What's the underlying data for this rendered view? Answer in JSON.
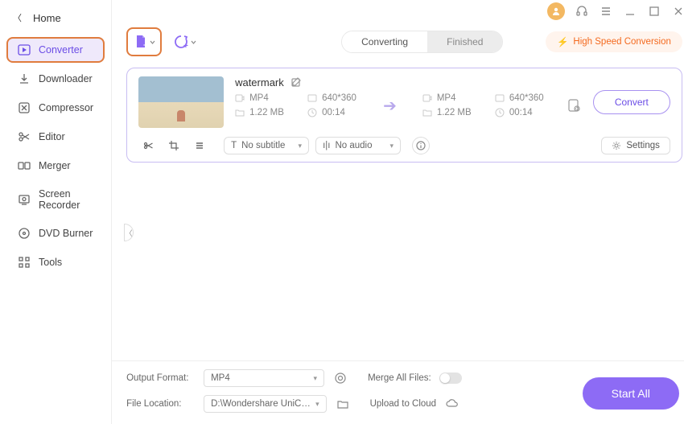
{
  "home": {
    "label": "Home"
  },
  "sidebar": {
    "items": [
      {
        "label": "Converter"
      },
      {
        "label": "Downloader"
      },
      {
        "label": "Compressor"
      },
      {
        "label": "Editor"
      },
      {
        "label": "Merger"
      },
      {
        "label": "Screen Recorder"
      },
      {
        "label": "DVD Burner"
      },
      {
        "label": "Tools"
      }
    ]
  },
  "tabs": {
    "converting": "Converting",
    "finished": "Finished"
  },
  "speed_badge": "High Speed Conversion",
  "task": {
    "title": "watermark",
    "src": {
      "format": "MP4",
      "res": "640*360",
      "size": "1.22 MB",
      "dur": "00:14"
    },
    "dst": {
      "format": "MP4",
      "res": "640*360",
      "size": "1.22 MB",
      "dur": "00:14"
    },
    "subtitle": "No subtitle",
    "audio": "No audio",
    "settings": "Settings",
    "convert": "Convert"
  },
  "footer": {
    "output_format_label": "Output Format:",
    "output_format_value": "MP4",
    "merge_label": "Merge All Files:",
    "file_location_label": "File Location:",
    "file_location_value": "D:\\Wondershare UniConverter 1",
    "upload_label": "Upload to Cloud",
    "start_all": "Start All"
  }
}
